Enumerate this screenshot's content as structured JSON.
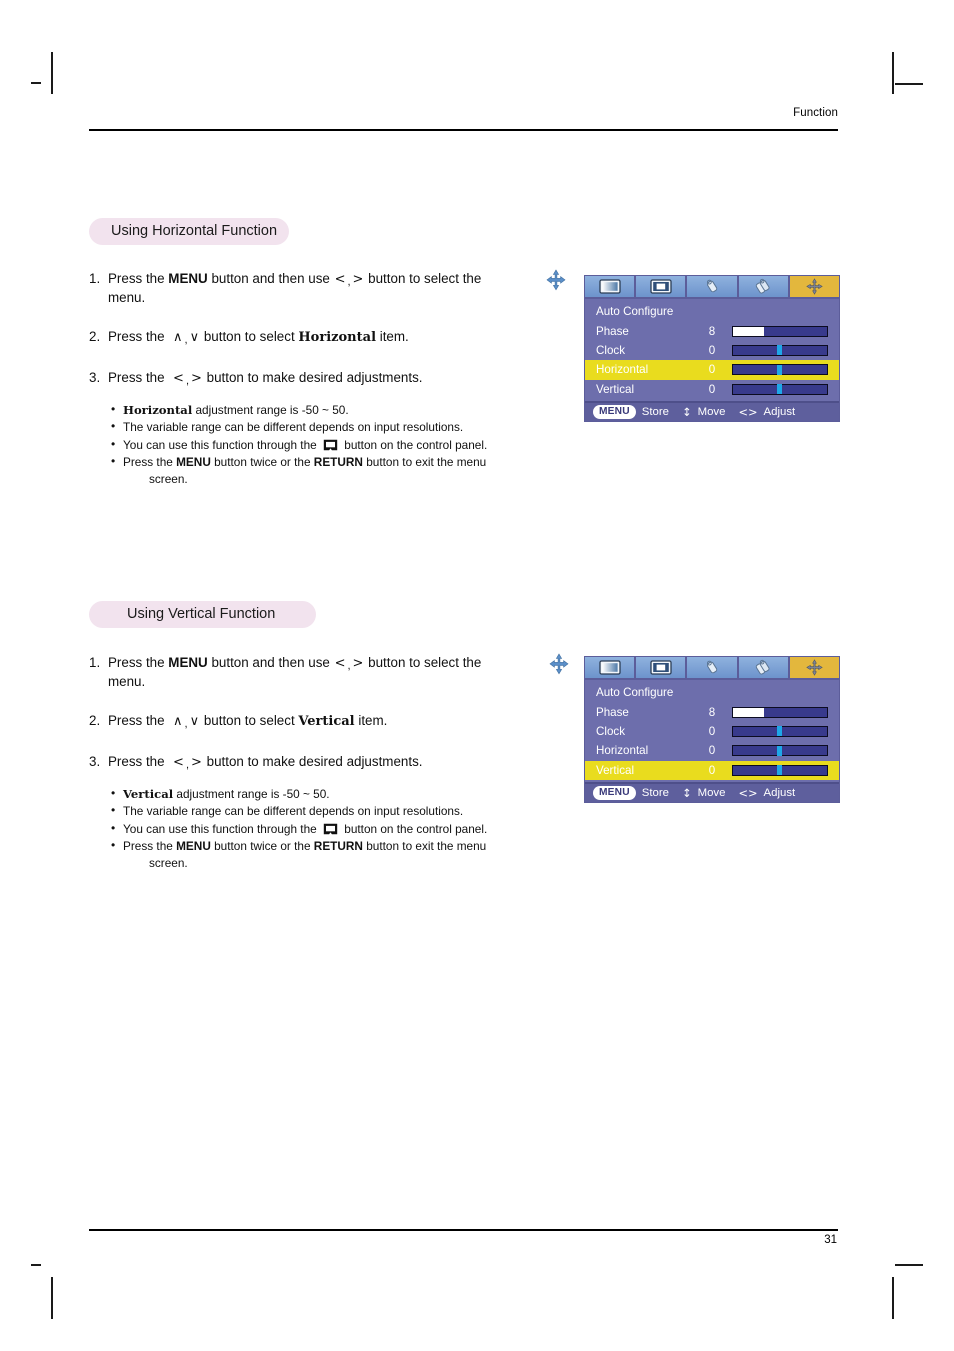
{
  "page": {
    "running_head": "Function",
    "page_number": "31"
  },
  "sections": [
    {
      "heading": "Using Horizontal Function",
      "steps": [
        {
          "num": "1.",
          "pre": "Press the ",
          "bold1": "MENU",
          "mid": " button and then use ",
          "g1": "<",
          "g2": ">",
          "post": " button to select the",
          "tail": "menu.",
          "icon": "move-4way-icon"
        },
        {
          "num": "2.",
          "pre": "Press the ",
          "g1": "∧",
          "g2": "∨",
          "mid": " button to select ",
          "bold1": "Horizontal",
          "post": " item."
        },
        {
          "num": "3.",
          "pre": "Press the ",
          "g1": "<",
          "g2": ">",
          "post": " button to make desired adjustments."
        }
      ],
      "notes": [
        {
          "bold_lead": "Horizontal",
          "text": " adjustment range is -50 ~ 50."
        },
        {
          "text": "The variable range can be different depends on input resolutions."
        },
        {
          "text_before_icon": "You can use this function through the ",
          "icon": "control-panel-button-icon",
          "text_after_icon": " button on the control panel."
        },
        {
          "text_a": "Press the ",
          "bold_a": "MENU",
          "text_b": " button twice or the ",
          "bold_b": "RETURN",
          "text_c": " button to exit the menu",
          "cont": "screen."
        }
      ],
      "osd": {
        "tabs": [
          {
            "icon": "picture-screen-icon",
            "active": false
          },
          {
            "icon": "picture-inset-icon",
            "active": false
          },
          {
            "icon": "speaker-single-icon",
            "active": false
          },
          {
            "icon": "speaker-double-icon",
            "active": false
          },
          {
            "icon": "move-4way-icon",
            "active": true
          }
        ],
        "rows": [
          {
            "label": "Auto Configure",
            "value": "",
            "bar": false,
            "selected": false
          },
          {
            "label": "Phase",
            "value": "8",
            "bar": true,
            "bar_type": "fill",
            "fill_percent": 33,
            "selected": false
          },
          {
            "label": "Clock",
            "value": "0",
            "bar": true,
            "bar_type": "marker",
            "marker_percent": 47,
            "selected": false
          },
          {
            "label": "Horizontal",
            "value": "0",
            "bar": true,
            "bar_type": "marker",
            "marker_percent": 47,
            "selected": true
          },
          {
            "label": "Vertical",
            "value": "0",
            "bar": true,
            "bar_type": "marker",
            "marker_percent": 47,
            "selected": false
          }
        ],
        "footer": {
          "menu_chip": "MENU",
          "store_label": "Store",
          "move_glyph": "↕",
          "move_label": "Move",
          "adjust_glyph": "<>",
          "adjust_label": "Adjust"
        }
      }
    },
    {
      "heading": "Using Vertical Function",
      "steps": [
        {
          "num": "1.",
          "pre": "Press the ",
          "bold1": "MENU",
          "mid": " button and then use ",
          "g1": "<",
          "g2": ">",
          "post": " button to select the",
          "tail": "menu.",
          "icon": "move-4way-icon"
        },
        {
          "num": "2.",
          "pre": "Press the ",
          "g1": "∧",
          "g2": "∨",
          "mid": " button to select ",
          "bold1": "Vertical",
          "post": " item."
        },
        {
          "num": "3.",
          "pre": "Press the ",
          "g1": "<",
          "g2": ">",
          "post": " button to make desired adjustments."
        }
      ],
      "notes": [
        {
          "bold_lead": "Vertical",
          "text": " adjustment range is -50 ~ 50."
        },
        {
          "text": "The variable range can be different depends on input resolutions."
        },
        {
          "text_before_icon": "You can use this function through the ",
          "icon": "control-panel-button-icon",
          "text_after_icon": " button on the control panel."
        },
        {
          "text_a": "Press the ",
          "bold_a": "MENU",
          "text_b": " button twice or the ",
          "bold_b": "RETURN",
          "text_c": " button to exit the menu",
          "cont": "screen."
        }
      ],
      "osd": {
        "tabs": [
          {
            "icon": "picture-screen-icon",
            "active": false
          },
          {
            "icon": "picture-inset-icon",
            "active": false
          },
          {
            "icon": "speaker-single-icon",
            "active": false
          },
          {
            "icon": "speaker-double-icon",
            "active": false
          },
          {
            "icon": "move-4way-icon",
            "active": true
          }
        ],
        "rows": [
          {
            "label": "Auto Configure",
            "value": "",
            "bar": false,
            "selected": false
          },
          {
            "label": "Phase",
            "value": "8",
            "bar": true,
            "bar_type": "fill",
            "fill_percent": 33,
            "selected": false
          },
          {
            "label": "Clock",
            "value": "0",
            "bar": true,
            "bar_type": "marker",
            "marker_percent": 47,
            "selected": false
          },
          {
            "label": "Horizontal",
            "value": "0",
            "bar": true,
            "bar_type": "marker",
            "marker_percent": 47,
            "selected": false
          },
          {
            "label": "Vertical",
            "value": "0",
            "bar": true,
            "bar_type": "marker",
            "marker_percent": 47,
            "selected": true
          }
        ],
        "footer": {
          "menu_chip": "MENU",
          "store_label": "Store",
          "move_glyph": "↕",
          "move_label": "Move",
          "adjust_glyph": "<>",
          "adjust_label": "Adjust"
        }
      }
    }
  ],
  "colors": {
    "pill_background": "#f2e3ee",
    "osd_background": "#6d6eac",
    "osd_tab_background": "#7b9fd4",
    "osd_tab_active": "#e3b73d",
    "osd_row_selected": "#e9dc1e",
    "osd_bar_track": "#383a8c",
    "osd_bar_marker": "#1ea7e8",
    "osd_bar_fill": "#ffffff",
    "osd_footer": "#5e5f9d"
  }
}
